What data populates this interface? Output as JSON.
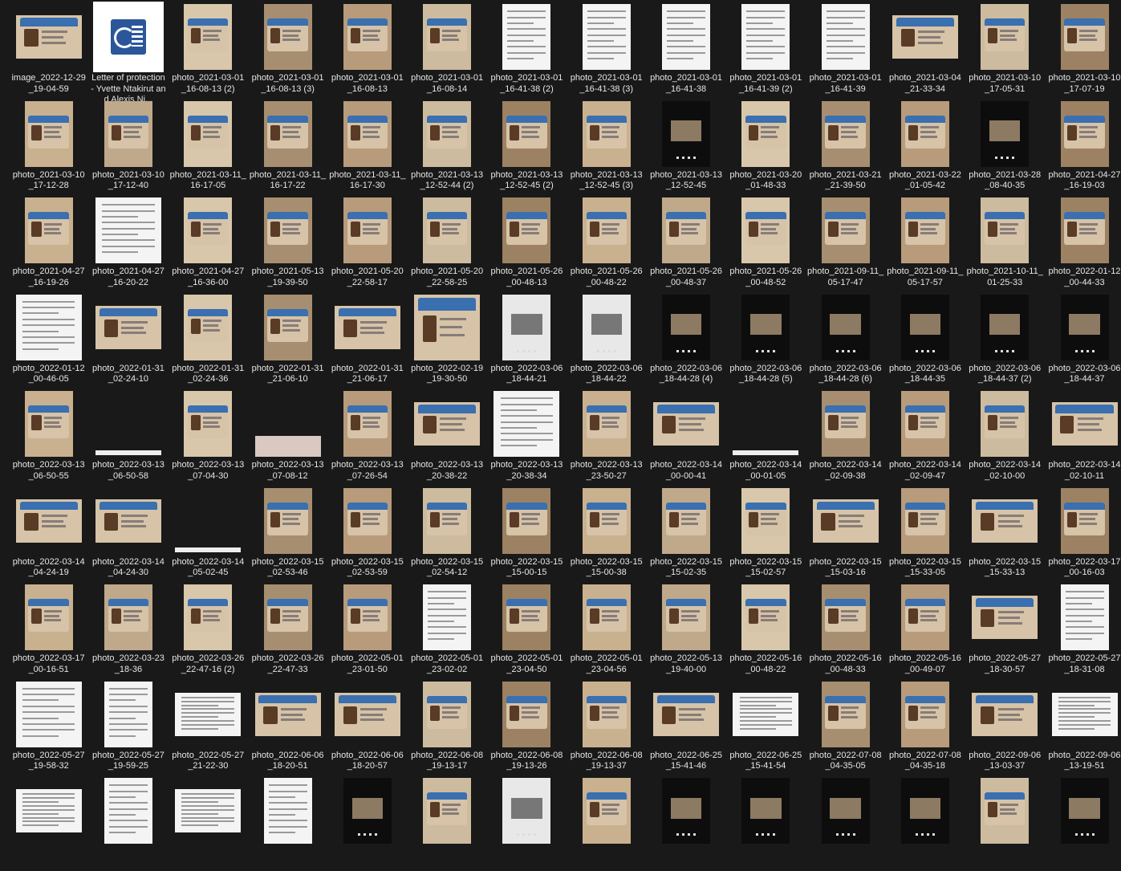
{
  "items": [
    {
      "name": "image_2022-12-29_19-04-59",
      "kind": "card"
    },
    {
      "name": "Letter of protection - Yvette Ntakirut and Alexis Ni...",
      "kind": "word",
      "icon": "word-document-icon"
    },
    {
      "name": "photo_2021-03-01_16-08-13 (2)",
      "kind": "card_tall"
    },
    {
      "name": "photo_2021-03-01_16-08-13 (3)",
      "kind": "card_tall"
    },
    {
      "name": "photo_2021-03-01_16-08-13",
      "kind": "card_tall"
    },
    {
      "name": "photo_2021-03-01_16-08-14",
      "kind": "card_tall"
    },
    {
      "name": "photo_2021-03-01_16-41-38 (2)",
      "kind": "paper_tall"
    },
    {
      "name": "photo_2021-03-01_16-41-38 (3)",
      "kind": "paper_tall"
    },
    {
      "name": "photo_2021-03-01_16-41-38",
      "kind": "paper_tall"
    },
    {
      "name": "photo_2021-03-01_16-41-39 (2)",
      "kind": "paper_tall"
    },
    {
      "name": "photo_2021-03-01_16-41-39",
      "kind": "paper_tall"
    },
    {
      "name": "photo_2021-03-04_21-33-34",
      "kind": "card"
    },
    {
      "name": "photo_2021-03-10_17-05-31",
      "kind": "card_tall"
    },
    {
      "name": "photo_2021-03-10_17-07-19",
      "kind": "card_tall"
    },
    {
      "name": "photo_2021-03-10_17-12-28",
      "kind": "card_tall"
    },
    {
      "name": "photo_2021-03-10_17-12-40",
      "kind": "card_tall"
    },
    {
      "name": "photo_2021-03-11_16-17-05",
      "kind": "card_tall"
    },
    {
      "name": "photo_2021-03-11_16-17-22",
      "kind": "card_tall"
    },
    {
      "name": "photo_2021-03-11_16-17-30",
      "kind": "card_tall"
    },
    {
      "name": "photo_2021-03-13_12-52-44 (2)",
      "kind": "card_tall"
    },
    {
      "name": "photo_2021-03-13_12-52-45 (2)",
      "kind": "card_tall"
    },
    {
      "name": "photo_2021-03-13_12-52-45 (3)",
      "kind": "card_tall"
    },
    {
      "name": "photo_2021-03-13_12-52-45",
      "kind": "phone"
    },
    {
      "name": "photo_2021-03-20_01-48-33",
      "kind": "card_tall"
    },
    {
      "name": "photo_2021-03-21_21-39-50",
      "kind": "card_tall"
    },
    {
      "name": "photo_2021-03-22_01-05-42",
      "kind": "card_tall"
    },
    {
      "name": "photo_2021-03-28_08-40-35",
      "kind": "phone"
    },
    {
      "name": "photo_2021-04-27_16-19-03",
      "kind": "card_tall"
    },
    {
      "name": "photo_2021-04-27_16-19-26",
      "kind": "card_tall"
    },
    {
      "name": "photo_2021-04-27_16-20-22",
      "kind": "paper_sq"
    },
    {
      "name": "photo_2021-04-27_16-36-00",
      "kind": "card_tall"
    },
    {
      "name": "photo_2021-05-13_19-39-50",
      "kind": "card_tall"
    },
    {
      "name": "photo_2021-05-20_22-58-17",
      "kind": "card_tall"
    },
    {
      "name": "photo_2021-05-20_22-58-25",
      "kind": "card_tall"
    },
    {
      "name": "photo_2021-05-26_00-48-13",
      "kind": "card_tall"
    },
    {
      "name": "photo_2021-05-26_00-48-22",
      "kind": "card_tall"
    },
    {
      "name": "photo_2021-05-26_00-48-37",
      "kind": "card_tall"
    },
    {
      "name": "photo_2021-05-26_00-48-52",
      "kind": "card_tall"
    },
    {
      "name": "photo_2021-09-11_05-17-47",
      "kind": "card_tall"
    },
    {
      "name": "photo_2021-09-11_05-17-57",
      "kind": "card_tall"
    },
    {
      "name": "photo_2021-10-11_01-25-33",
      "kind": "card_tall"
    },
    {
      "name": "photo_2022-01-12_00-44-33",
      "kind": "card_tall"
    },
    {
      "name": "photo_2022-01-12_00-46-05",
      "kind": "paper_sq"
    },
    {
      "name": "photo_2022-01-31_02-24-10",
      "kind": "card"
    },
    {
      "name": "photo_2022-01-31_02-24-36",
      "kind": "card_tall"
    },
    {
      "name": "photo_2022-01-31_21-06-10",
      "kind": "card_tall"
    },
    {
      "name": "photo_2022-01-31_21-06-17",
      "kind": "card"
    },
    {
      "name": "photo_2022-02-19_19-30-50",
      "kind": "card_sq"
    },
    {
      "name": "photo_2022-03-06_18-44-21",
      "kind": "phone_light"
    },
    {
      "name": "photo_2022-03-06_18-44-22",
      "kind": "phone_light"
    },
    {
      "name": "photo_2022-03-06_18-44-28 (4)",
      "kind": "phone"
    },
    {
      "name": "photo_2022-03-06_18-44-28 (5)",
      "kind": "phone"
    },
    {
      "name": "photo_2022-03-06_18-44-28 (6)",
      "kind": "phone"
    },
    {
      "name": "photo_2022-03-06_18-44-35",
      "kind": "phone"
    },
    {
      "name": "photo_2022-03-06_18-44-37 (2)",
      "kind": "phone"
    },
    {
      "name": "photo_2022-03-06_18-44-37",
      "kind": "phone"
    },
    {
      "name": "photo_2022-03-13_06-50-55",
      "kind": "card_tall"
    },
    {
      "name": "photo_2022-03-13_06-50-58",
      "kind": "blank"
    },
    {
      "name": "photo_2022-03-13_07-04-30",
      "kind": "card_tall"
    },
    {
      "name": "photo_2022-03-13_07-08-12",
      "kind": "card_strip"
    },
    {
      "name": "photo_2022-03-13_07-26-54",
      "kind": "card_tall"
    },
    {
      "name": "photo_2022-03-13_20-38-22",
      "kind": "card"
    },
    {
      "name": "photo_2022-03-13_20-38-34",
      "kind": "paper_sq"
    },
    {
      "name": "photo_2022-03-13_23-50-27",
      "kind": "card_tall"
    },
    {
      "name": "photo_2022-03-14_00-00-41",
      "kind": "card"
    },
    {
      "name": "photo_2022-03-14_00-01-05",
      "kind": "blank"
    },
    {
      "name": "photo_2022-03-14_02-09-38",
      "kind": "card_tall"
    },
    {
      "name": "photo_2022-03-14_02-09-47",
      "kind": "card_tall"
    },
    {
      "name": "photo_2022-03-14_02-10-00",
      "kind": "card_tall"
    },
    {
      "name": "photo_2022-03-14_02-10-11",
      "kind": "card"
    },
    {
      "name": "photo_2022-03-14_04-24-19",
      "kind": "card"
    },
    {
      "name": "photo_2022-03-14_04-24-30",
      "kind": "card"
    },
    {
      "name": "photo_2022-03-14_05-02-45",
      "kind": "blank"
    },
    {
      "name": "photo_2022-03-15_02-53-46",
      "kind": "card_tall"
    },
    {
      "name": "photo_2022-03-15_02-53-59",
      "kind": "card_tall"
    },
    {
      "name": "photo_2022-03-15_02-54-12",
      "kind": "card_tall"
    },
    {
      "name": "photo_2022-03-15_15-00-15",
      "kind": "card_tall"
    },
    {
      "name": "photo_2022-03-15_15-00-38",
      "kind": "card_tall"
    },
    {
      "name": "photo_2022-03-15_15-02-35",
      "kind": "card_tall"
    },
    {
      "name": "photo_2022-03-15_15-02-57",
      "kind": "card_tall"
    },
    {
      "name": "photo_2022-03-15_15-03-16",
      "kind": "card"
    },
    {
      "name": "photo_2022-03-15_15-33-05",
      "kind": "card_tall"
    },
    {
      "name": "photo_2022-03-15_15-33-13",
      "kind": "card"
    },
    {
      "name": "photo_2022-03-17_00-16-03",
      "kind": "card_tall"
    },
    {
      "name": "photo_2022-03-17_00-16-51",
      "kind": "card_tall"
    },
    {
      "name": "photo_2022-03-23_18-36",
      "kind": "card_tall"
    },
    {
      "name": "photo_2022-03-26_22-47-16 (2)",
      "kind": "card_tall"
    },
    {
      "name": "photo_2022-03-26_22-47-33",
      "kind": "card_tall"
    },
    {
      "name": "photo_2022-05-01_23-01-50",
      "kind": "card_tall"
    },
    {
      "name": "photo_2022-05-01_23-02-02",
      "kind": "paper_tall"
    },
    {
      "name": "photo_2022-05-01_23-04-50",
      "kind": "card_tall"
    },
    {
      "name": "photo_2022-05-01_23-04-56",
      "kind": "card_tall"
    },
    {
      "name": "photo_2022-05-13_19-40-00",
      "kind": "card_tall"
    },
    {
      "name": "photo_2022-05-16_00-48-22",
      "kind": "card_tall"
    },
    {
      "name": "photo_2022-05-16_00-48-33",
      "kind": "card_tall"
    },
    {
      "name": "photo_2022-05-16_00-49-07",
      "kind": "card_tall"
    },
    {
      "name": "photo_2022-05-27_18-30-57",
      "kind": "card"
    },
    {
      "name": "photo_2022-05-27_18-31-08",
      "kind": "paper_tall"
    },
    {
      "name": "photo_2022-05-27_19-58-32",
      "kind": "paper_sq"
    },
    {
      "name": "photo_2022-05-27_19-59-25",
      "kind": "paper_tall"
    },
    {
      "name": "photo_2022-05-27_21-22-30",
      "kind": "paper_wide"
    },
    {
      "name": "photo_2022-06-06_18-20-51",
      "kind": "card"
    },
    {
      "name": "photo_2022-06-06_18-20-57",
      "kind": "card"
    },
    {
      "name": "photo_2022-06-08_19-13-17",
      "kind": "card_tall"
    },
    {
      "name": "photo_2022-06-08_19-13-26",
      "kind": "card_tall"
    },
    {
      "name": "photo_2022-06-08_19-13-37",
      "kind": "card_tall"
    },
    {
      "name": "photo_2022-06-25_15-41-46",
      "kind": "card"
    },
    {
      "name": "photo_2022-06-25_15-41-54",
      "kind": "paper_wide"
    },
    {
      "name": "photo_2022-07-08_04-35-05",
      "kind": "card_tall"
    },
    {
      "name": "photo_2022-07-08_04-35-18",
      "kind": "card_tall"
    },
    {
      "name": "photo_2022-09-06_13-03-37",
      "kind": "card"
    },
    {
      "name": "photo_2022-09-06_13-19-51",
      "kind": "paper_wide"
    },
    {
      "name": "",
      "kind": "paper_wide"
    },
    {
      "name": "",
      "kind": "paper_tall"
    },
    {
      "name": "",
      "kind": "paper_wide"
    },
    {
      "name": "",
      "kind": "paper_tall"
    },
    {
      "name": "",
      "kind": "phone"
    },
    {
      "name": "",
      "kind": "card_tall"
    },
    {
      "name": "",
      "kind": "phone_light"
    },
    {
      "name": "",
      "kind": "card_tall"
    },
    {
      "name": "",
      "kind": "phone"
    },
    {
      "name": "",
      "kind": "phone"
    },
    {
      "name": "",
      "kind": "phone"
    },
    {
      "name": "",
      "kind": "phone"
    },
    {
      "name": "",
      "kind": "card_tall"
    },
    {
      "name": "",
      "kind": "phone"
    }
  ],
  "colors": {
    "background": "#191919",
    "label": "#e6e6e6",
    "id_card": "#d6c3a8",
    "id_header": "#3a6fb0",
    "paper": "#f4f4f4",
    "phone": "#0d0d0d",
    "word_blue": "#2b579a"
  }
}
